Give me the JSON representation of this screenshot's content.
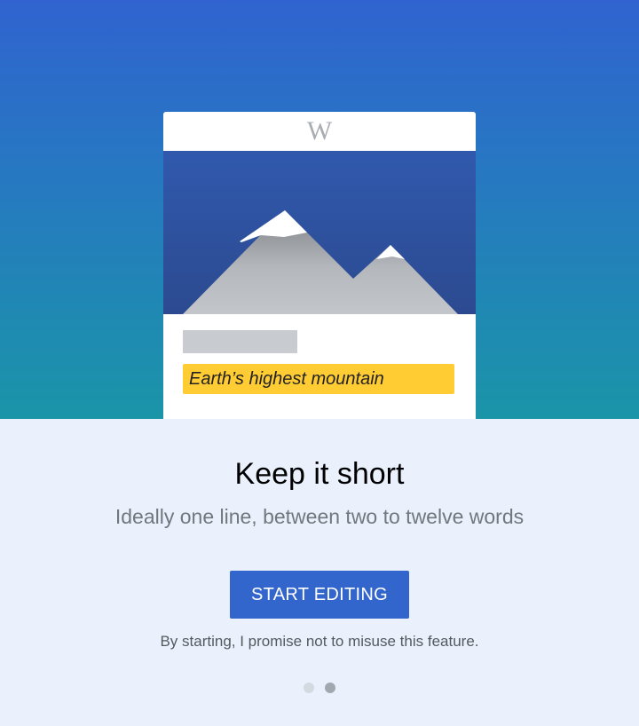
{
  "illustration": {
    "logo_text": "W",
    "description_text": "Earth’s highest mountain"
  },
  "onboarding": {
    "title": "Keep it short",
    "subtitle": "Ideally one line, between two to twelve words",
    "button_label": "START EDITING",
    "disclaimer": "By starting, I promise not to misuse this feature."
  },
  "pager": {
    "pages": 2,
    "current": 2
  },
  "colors": {
    "gradient_top": "#3063cf",
    "gradient_bottom": "#1a95a8",
    "accent": "#3366cc",
    "highlight": "#ffcc33",
    "background": "#eaf1fd",
    "dot_inactive": "#d5d9e0",
    "dot_active": "#a2a7b0"
  }
}
